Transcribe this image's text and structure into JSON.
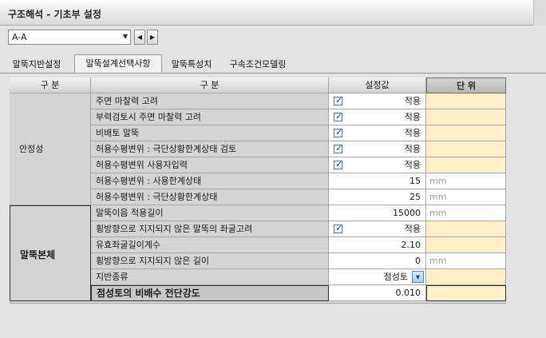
{
  "window": {
    "title": "구조해석 - 기초부 설정"
  },
  "section": {
    "selected": "A-A"
  },
  "tabs": [
    {
      "label": "말뚝지반설정"
    },
    {
      "label": "말뚝설계선택사항"
    },
    {
      "label": "말뚝특성치"
    },
    {
      "label": "구속조건모델링"
    }
  ],
  "grid": {
    "headers": {
      "category": "구 분",
      "item": "구 분",
      "value": "설정값",
      "unit": "단 위"
    },
    "groups": [
      {
        "label": "안정성"
      },
      {
        "label": "말뚝본체"
      }
    ],
    "rows": [
      {
        "name": "주면 마찰력 고려",
        "checked": true,
        "value": "적용",
        "unit": ""
      },
      {
        "name": "부력검토시 주면 마찰력 고려",
        "checked": true,
        "value": "적용",
        "unit": ""
      },
      {
        "name": "비배토 말뚝",
        "checked": true,
        "value": "적용",
        "unit": ""
      },
      {
        "name": "허용수평변위 : 극단상황한계상태 검토",
        "checked": true,
        "value": "적용",
        "unit": ""
      },
      {
        "name": "허용수평변위 사용자입력",
        "checked": true,
        "value": "적용",
        "unit": ""
      },
      {
        "name": "허용수평변위 : 사용한계상태",
        "value": "15",
        "unit": "mm"
      },
      {
        "name": "허용수평변위 : 극단상황한계상태",
        "value": "25",
        "unit": "mm"
      },
      {
        "name": "말뚝이음 적용길이",
        "value": "15000",
        "unit": "mm"
      },
      {
        "name": "횡방향으로 지지되지 않은 말뚝의 좌굴고려",
        "checked": true,
        "value": "적용",
        "unit": ""
      },
      {
        "name": "유효좌굴길이계수",
        "value": "2.10",
        "unit": ""
      },
      {
        "name": "횡방향으로 지지되지 않은 길이",
        "value": "0",
        "unit": "mm"
      },
      {
        "name": "지반종류",
        "value": "점성토",
        "unit": ""
      },
      {
        "name": "점성토의 비배수 전단강도",
        "value": "0.010",
        "unit": ""
      }
    ]
  }
}
